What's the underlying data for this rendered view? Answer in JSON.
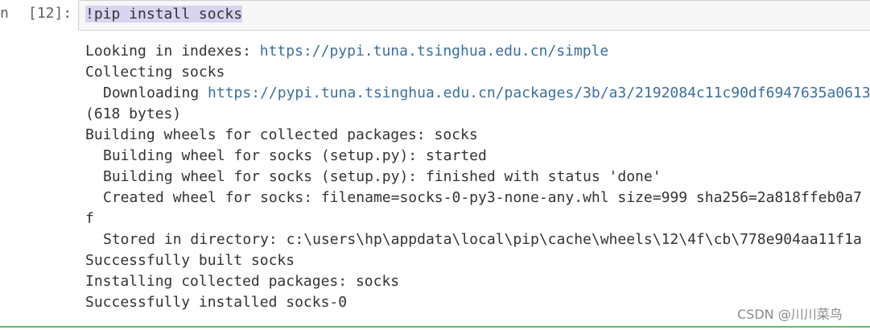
{
  "cell": {
    "prompt_prefix": "n",
    "prompt_label": "[12]:",
    "input_code": "!pip install socks"
  },
  "output": {
    "line1_text": "Looking in indexes: ",
    "line1_url": "https://pypi.tuna.tsinghua.edu.cn/simple",
    "line2": "Collecting socks",
    "line3_text": "Downloading ",
    "line3_url": "https://pypi.tuna.tsinghua.edu.cn/packages/3b/a3/2192084c11c90df6947635a0613",
    "line4": "(618 bytes)",
    "line5": "Building wheels for collected packages: socks",
    "line6": "Building wheel for socks (setup.py): started",
    "line7": "Building wheel for socks (setup.py): finished with status 'done'",
    "line8": "Created wheel for socks: filename=socks-0-py3-none-any.whl size=999 sha256=2a818ffeb0a7",
    "line9": "f",
    "line10": "Stored in directory: c:\\users\\hp\\appdata\\local\\pip\\cache\\wheels\\12\\4f\\cb\\778e904aa11f1a",
    "line11": "Successfully built socks",
    "line12": "Installing collected packages: socks",
    "line13": "Successfully installed socks-0"
  },
  "watermark": "CSDN @川川菜鸟",
  "colors": {
    "url": "#3a6f9f",
    "selection": "#d7d4f0",
    "input_bg": "#f7f7f7",
    "cell_border": "#66bb6a"
  }
}
